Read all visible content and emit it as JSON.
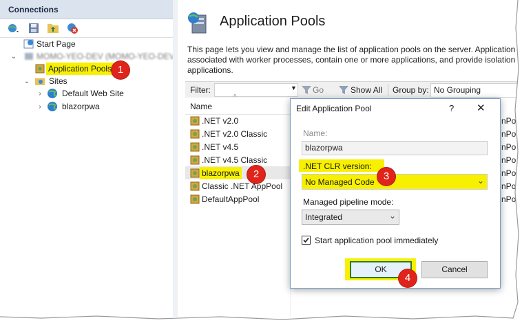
{
  "connections": {
    "title": "Connections",
    "tree": {
      "start_page": "Start Page",
      "server": "MOMO-YEO-DEV (MOMO-YEO-DEV\\...",
      "application_pools": "Application Pools",
      "sites": "Sites",
      "site_items": [
        "Default Web Site",
        "blazorpwa"
      ]
    }
  },
  "main": {
    "title": "Application Pools",
    "description": [
      "This page lets you view and manage the list of application pools on the server. Application",
      "associated with worker processes, contain one or more applications, and provide isolation",
      "applications."
    ],
    "filter_label": "Filter:",
    "go_label": "Go",
    "show_all_label": "Show All",
    "group_by_label": "Group by:",
    "group_by_value": "No Grouping",
    "column_name": "Name",
    "pools": [
      ".NET v2.0",
      ".NET v2.0 Classic",
      ".NET v4.5",
      ".NET v4.5 Classic",
      "blazorpwa",
      "Classic .NET AppPool",
      "DefaultAppPool"
    ],
    "status_partial": [
      "nPo",
      "nPo",
      "nPo",
      "nPo",
      "nPo",
      "nPo",
      "nPo"
    ]
  },
  "dialog": {
    "title": "Edit Application Pool",
    "help": "?",
    "close": "✕",
    "name_label": "Name:",
    "name_value": "blazorpwa",
    "clr_label": ".NET CLR version:",
    "clr_value": "No Managed Code",
    "pipeline_label": "Managed pipeline mode:",
    "pipeline_value": "Integrated",
    "start_label": "Start application pool immediately",
    "start_checked": true,
    "ok_label": "OK",
    "cancel_label": "Cancel"
  },
  "callouts": [
    "1",
    "2",
    "3",
    "4"
  ],
  "colors": {
    "highlight": "#f7f000",
    "callout": "#e0241b",
    "header": "#dbe3ee"
  }
}
